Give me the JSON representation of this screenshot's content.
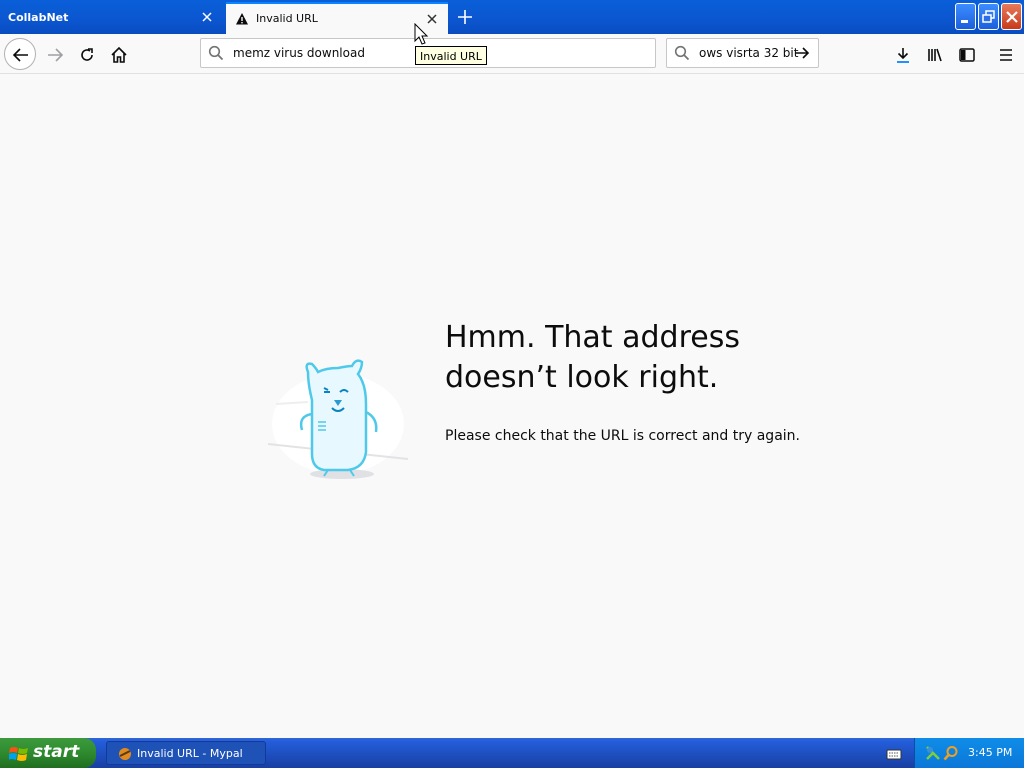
{
  "tabs": [
    {
      "label": "CollabNet",
      "active": false
    },
    {
      "label": "Invalid URL",
      "active": true
    }
  ],
  "urlbar": {
    "value": "memz virus download"
  },
  "searchbar": {
    "value": "ows visrta 32 bit"
  },
  "tooltip": "Invalid URL",
  "error": {
    "title": "Hmm. That address doesn’t look right.",
    "description": "Please check that the URL is correct and try again."
  },
  "taskbar": {
    "start_label": "start",
    "window_label": "Invalid URL - Mypal",
    "clock": "3:45 PM"
  },
  "colors": {
    "accent": "#0a84ff",
    "titlebar": "#0b56d0",
    "taskbar": "#245edb",
    "start": "#2f8a2f"
  },
  "icons": [
    "warning-icon",
    "close-icon",
    "plus-icon",
    "back-icon",
    "forward-icon",
    "reload-icon",
    "home-icon",
    "search-icon",
    "arrow-right-icon",
    "download-icon",
    "library-icon",
    "sidebar-icon",
    "menu-icon"
  ]
}
